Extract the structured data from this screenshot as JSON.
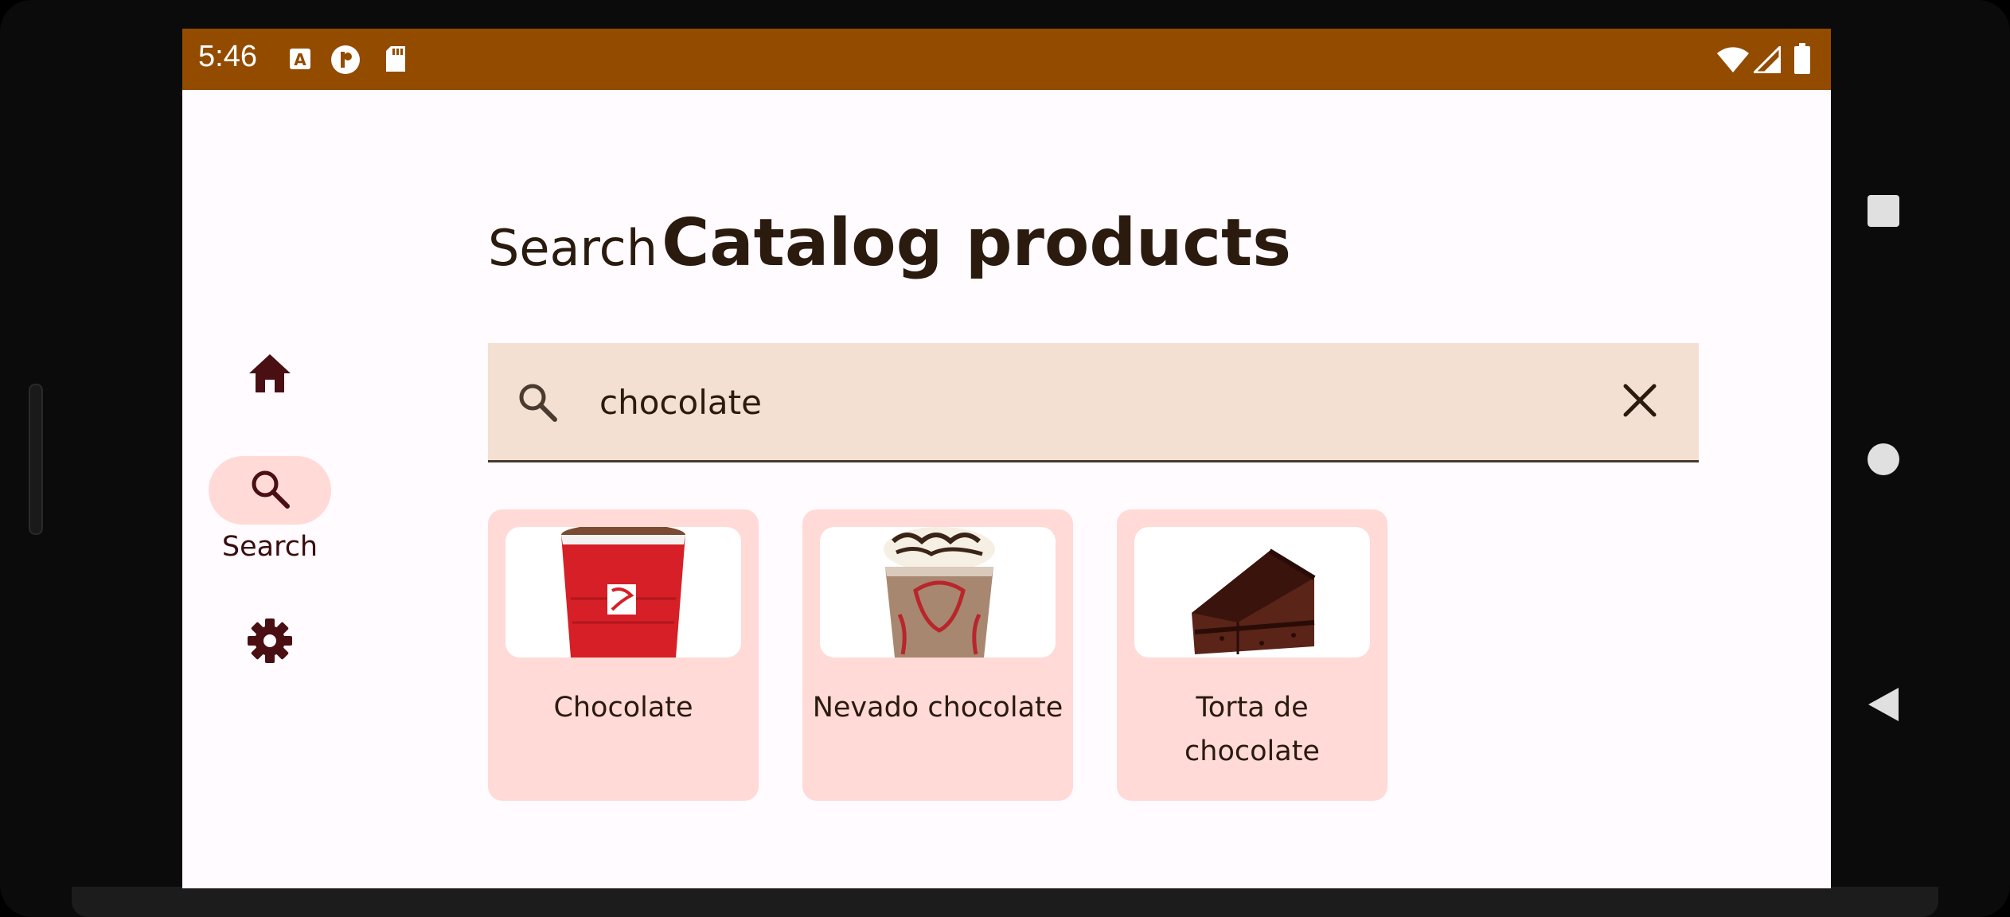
{
  "status_bar": {
    "time": "5:46",
    "color": "#934b00"
  },
  "page": {
    "title_prefix": "Search",
    "title_main": "Catalog products"
  },
  "nav": {
    "items": [
      {
        "id": "home",
        "label": "",
        "icon": "home-icon",
        "active": false
      },
      {
        "id": "search",
        "label": "Search",
        "icon": "search-icon",
        "active": true
      },
      {
        "id": "settings",
        "label": "",
        "icon": "gear-icon",
        "active": false
      }
    ]
  },
  "search": {
    "value": "chocolate",
    "placeholder": ""
  },
  "results": [
    {
      "name": "Chocolate",
      "image": "red-cup-hot-chocolate"
    },
    {
      "name": "Nevado chocolate",
      "image": "iced-chocolate-drink"
    },
    {
      "name": "Torta de chocolate",
      "image": "chocolate-cake-slice"
    }
  ],
  "colors": {
    "accent": "#934b00",
    "card_bg": "#ffdad6",
    "search_bg": "#f3e0d2",
    "text": "#2a1b0e"
  }
}
